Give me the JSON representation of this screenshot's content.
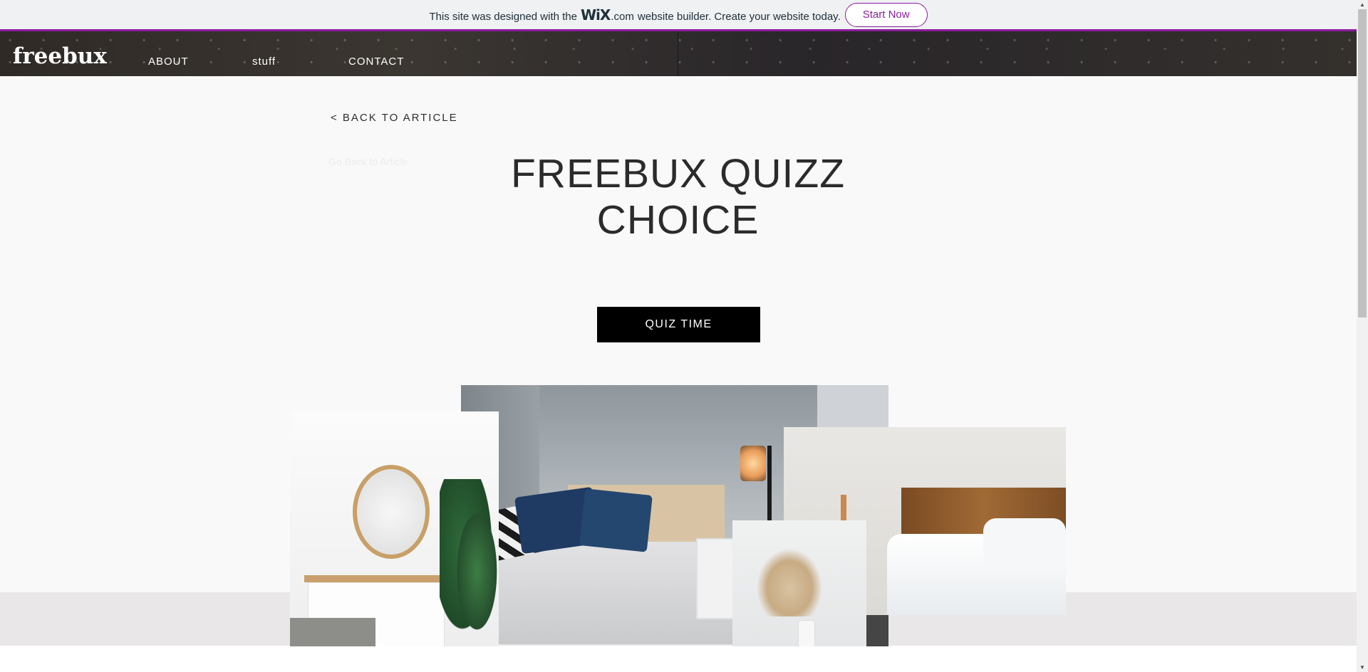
{
  "wix_banner": {
    "text_before": "This site was designed with the",
    "wix_logo": "WiX",
    "dotcom": ".com",
    "text_after": "website builder. Create your website today.",
    "start_button": "Start Now",
    "accent_color": "#8b1d9e"
  },
  "header": {
    "logo": "freebux",
    "nav": [
      {
        "label": "ABOUT"
      },
      {
        "label": "stuff"
      },
      {
        "label": "CONTACT"
      }
    ]
  },
  "main": {
    "back_link": "< BACK TO ARTICLE",
    "faint_link": "Go Back to Article",
    "title_line1": "FREEBUX QUIZZ",
    "title_line2": "CHOICE",
    "quiz_button": "QUIZ TIME"
  },
  "gallery": {
    "photos": [
      "bedroom-photo",
      "vanity-photo",
      "wooden-bed-photo",
      "pampas-grass-photo"
    ]
  },
  "scrollbar": {
    "up_icon": "triangle-up-icon",
    "down_icon": "triangle-down-icon"
  }
}
